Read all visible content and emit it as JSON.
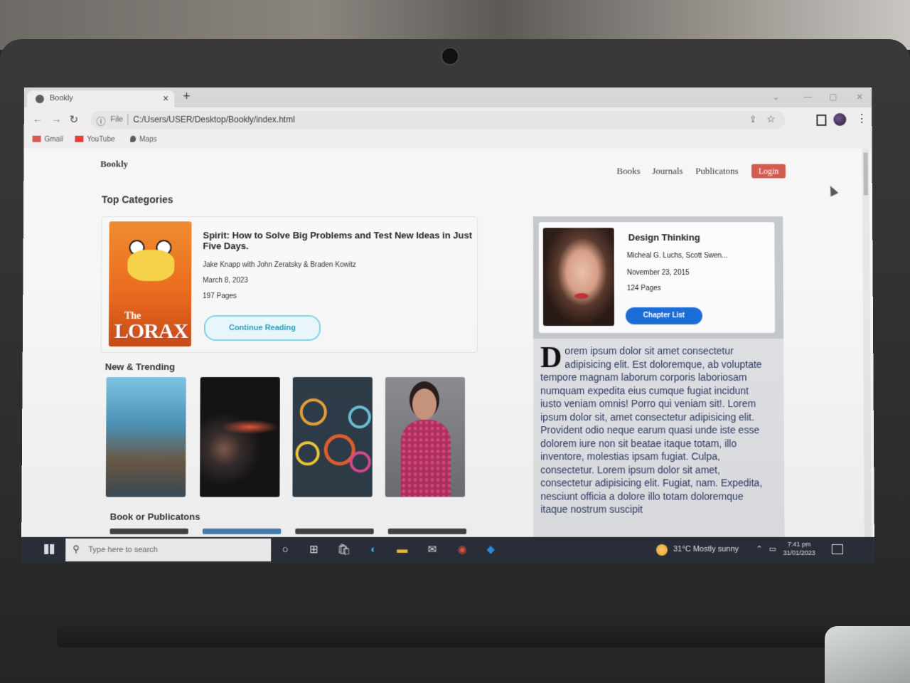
{
  "browser": {
    "tab_title": "Bookly",
    "tab_close": "×",
    "new_tab": "+",
    "url_scheme": "File",
    "url": "C:/Users/USER/Desktop/Bookly/index.html",
    "bookmarks": [
      "Gmail",
      "YouTube",
      "Maps"
    ]
  },
  "site": {
    "brand": "Bookly",
    "nav": [
      "Books",
      "Journals",
      "Publicatons"
    ],
    "login": "Login",
    "top_categories": "Top Categories",
    "featured": {
      "cover_title": "LORAX",
      "cover_the": "The",
      "title": "Spirit: How to Solve Big Problems and Test New Ideas in Just Five Days.",
      "authors": "Jake Knapp with John Zeratsky & Braden Kowitz",
      "date": "March 8, 2023",
      "pages": "197 Pages",
      "button": "Continue Reading"
    },
    "new_trending": "New & Trending",
    "book_or_publications": "Book or Publicatons",
    "design_card": {
      "title": "Design Thinking",
      "authors": "Micheal G. Luchs, Scott Swen...",
      "date": "November 23, 2015",
      "pages": "124 Pages",
      "button": "Chapter List"
    },
    "lorem_dropcap": "D",
    "lorem_text": "orem ipsum dolor sit amet consectetur adipisicing elit. Est doloremque, ab voluptate tempore magnam laborum corporis laboriosam numquam expedita eius cumque fugiat incidunt iusto veniam omnis! Porro qui veniam sit!. Lorem ipsum dolor sit, amet consectetur adipisicing elit. Provident odio neque earum quasi unde iste esse dolorem iure non sit beatae itaque totam, illo inventore, molestias ipsam fugiat. Culpa, consectetur. Lorem ipsum dolor sit amet, consectetur adipisicing elit. Fugiat, nam. Expedita, nesciunt officia a dolore illo totam doloremque itaque nostrum suscipit"
  },
  "taskbar": {
    "search_placeholder": "Type here to search",
    "weather": "31°C  Mostly sunny",
    "time": "7:41 pm",
    "date": "31/01/2023"
  },
  "colors": {
    "login_bg": "#d4574a",
    "continue_border": "#7fd3e6",
    "chapter_bg": "#1c6fd8",
    "taskbar_bg": "#2a2f3a"
  }
}
